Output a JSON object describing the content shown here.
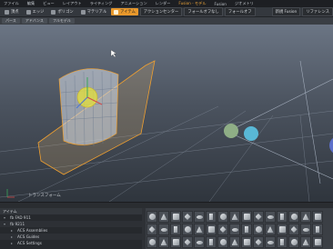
{
  "menubar": {
    "items": [
      {
        "label": "ファイル",
        "accent": false
      },
      {
        "label": "編集",
        "accent": false
      },
      {
        "label": "ビュー",
        "accent": false
      },
      {
        "label": "レイアウト",
        "accent": false
      },
      {
        "label": "ライティング",
        "accent": false
      },
      {
        "label": "アニメーション",
        "accent": false
      },
      {
        "label": "レンダー",
        "accent": false
      },
      {
        "label": "Fusion - モデル",
        "accent": true
      },
      {
        "label": "Fusion",
        "accent": false
      },
      {
        "label": "ジオメトリ",
        "accent": false
      }
    ]
  },
  "toolbar": {
    "items": [
      {
        "label": "頂点",
        "active": false
      },
      {
        "label": "エッジ",
        "active": false
      },
      {
        "label": "ポリゴン",
        "active": false
      },
      {
        "label": "マテリアル",
        "active": false
      },
      {
        "label": "アイテム",
        "active": true
      }
    ],
    "action_center": "アクションセンター",
    "falloff": "フォールオフなし",
    "symmetry": "フォールオフ",
    "right_button_1": "新規 Fusion",
    "right_button_2": "リファレンス"
  },
  "view_tabs": [
    "パース",
    "アドバンス",
    "フルモデル"
  ],
  "viewport": {
    "label": "トランスフォーム"
  },
  "statusbar": {
    "text": ""
  },
  "tree": {
    "header": "アイテム",
    "items": [
      {
        "label": "fb FAD 911",
        "expanded": true,
        "sub": false
      },
      {
        "label": "fb 9211",
        "expanded": true,
        "sub": false
      },
      {
        "label": "ACS Assemblies",
        "expanded": false,
        "sub": true
      },
      {
        "label": "ACS Guides",
        "expanded": false,
        "sub": true
      },
      {
        "label": "ACS Settings",
        "expanded": false,
        "sub": true
      }
    ]
  },
  "preset_browser": {
    "count": 45
  },
  "colors": {
    "accent": "#e8982c",
    "selection": "#f0a030",
    "gizmo_yellow": "#e7e23a",
    "sphere_green": "#8fae86",
    "sphere_cyan": "#59b8d6"
  }
}
